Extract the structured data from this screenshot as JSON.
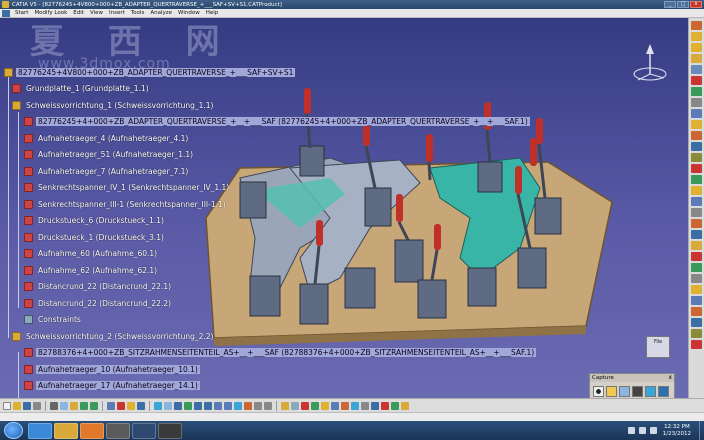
{
  "window": {
    "title": "CATIA V5 - [82776245+4V800+000+ZB_ADAPTER_QUERTRAVERSE_+___SAF+SV+S1.CATProduct]",
    "min": "_",
    "max": "□",
    "close": "x"
  },
  "menu": [
    "Start",
    "Modify Look",
    "Edit",
    "View",
    "Insert",
    "Tools",
    "Analyze",
    "Window",
    "Help"
  ],
  "watermark": {
    "logo": "夏 西 网",
    "url": "www.3dmox.com"
  },
  "tree": [
    {
      "label": "82776245+4V800+000+ZB_ADAPTER_QUERTRAVERSE_+___SAF+SV+S1",
      "type": "asm",
      "level": 0,
      "selected": true
    },
    {
      "label": "Grundplatte_1 (Grundplatte_1.1)",
      "type": "part",
      "level": 1
    },
    {
      "label": "Schweissvorrichtung_1 (Schweissvorrichtung_1.1)",
      "type": "asm",
      "level": 1
    },
    {
      "label": "82776245+4+000+ZB_ADAPTER_QUERTRAVERSE_+__+___SAF (82776245+4+000+ZB_ADAPTER_QUERTRAVERSE_+__+___SAF.1)",
      "type": "part",
      "level": 2,
      "selected": true
    },
    {
      "label": "Aufnahetraeger_4 (Aufnahetraeger_4.1)",
      "type": "part",
      "level": 2
    },
    {
      "label": "Aufnahetraeger_51 (Aufnahetraeger_1.1)",
      "type": "part",
      "level": 2
    },
    {
      "label": "Aufnahetraeger_7 (Aufnahetraeger_7.1)",
      "type": "part",
      "level": 2
    },
    {
      "label": "Senkrechtspanner_IV_1 (Senkrechtspanner_IV_1.1)",
      "type": "part",
      "level": 2
    },
    {
      "label": "Senkrechtspanner_III-1 (Senkrechtspanner_III-1.1)",
      "type": "part",
      "level": 2
    },
    {
      "label": "Druckstueck_6 (Druckstueck_1.1)",
      "type": "part",
      "level": 2
    },
    {
      "label": "Druckstueck_1 (Druckstueck_3.1)",
      "type": "part",
      "level": 2
    },
    {
      "label": "Aufnahme_60 (Aufnahme_60.1)",
      "type": "part",
      "level": 2
    },
    {
      "label": "Aufnahme_62 (Aufnahme_62.1)",
      "type": "part",
      "level": 2
    },
    {
      "label": "Distancrund_22 (Distancrund_22.1)",
      "type": "part",
      "level": 2
    },
    {
      "label": "Distancrund_22 (Distancrund_22.2)",
      "type": "part",
      "level": 2
    },
    {
      "label": "Constraints",
      "type": "constr",
      "level": 2
    },
    {
      "label": "Schweissvorrichtung_2 (Schweissvorrichtung_2.2)",
      "type": "asm",
      "level": 1
    },
    {
      "label": "82788376+4+000+ZB_SITZRAHMENSEITENTEIL_AS+__+___SAF (82788376+4+000+ZB_SITZRAHMENSEITENTEIL_AS+__+___SAF.1)",
      "type": "part",
      "level": 2,
      "selected": true
    },
    {
      "label": "Aufnahetraeger_10 (Aufnahetraeger_10.1)",
      "type": "part",
      "level": 2,
      "selected": true
    },
    {
      "label": "Aufnahetraeger_17 (Aufnahetraeger_14.1)",
      "type": "part",
      "level": 2,
      "selected": true
    }
  ],
  "capture": {
    "title": "Capture",
    "close": "x"
  },
  "file_button": {
    "label": "File"
  },
  "status": {
    "text": ""
  },
  "clock": {
    "time": "12:32 PM",
    "date": "1/23/2012"
  },
  "colors": {
    "viewport_top": "#353b82",
    "viewport_bottom": "#6b6bb3",
    "base_plate": "#c7a777",
    "clamp_block": "#5e6b82",
    "clamp_handle": "#c03028",
    "teal_part": "#39b5a8",
    "grey_part": "#9aa6b8"
  }
}
